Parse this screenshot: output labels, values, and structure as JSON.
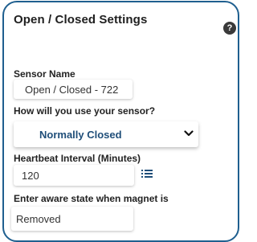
{
  "panel": {
    "title": "Open / Closed Settings",
    "help_icon": "question-icon",
    "help_glyph": "?"
  },
  "sensor_name": {
    "label": "Sensor Name",
    "value": "Open / Closed - 722"
  },
  "usage": {
    "label": "How will you use your sensor?",
    "selected": "Normally Closed",
    "icon": "chevron-down-icon"
  },
  "heartbeat": {
    "label": "Heartbeat Interval (Minutes)",
    "value": "120",
    "icon": "list-icon"
  },
  "aware_state": {
    "label": "Enter aware state when magnet is",
    "value": "Removed"
  }
}
